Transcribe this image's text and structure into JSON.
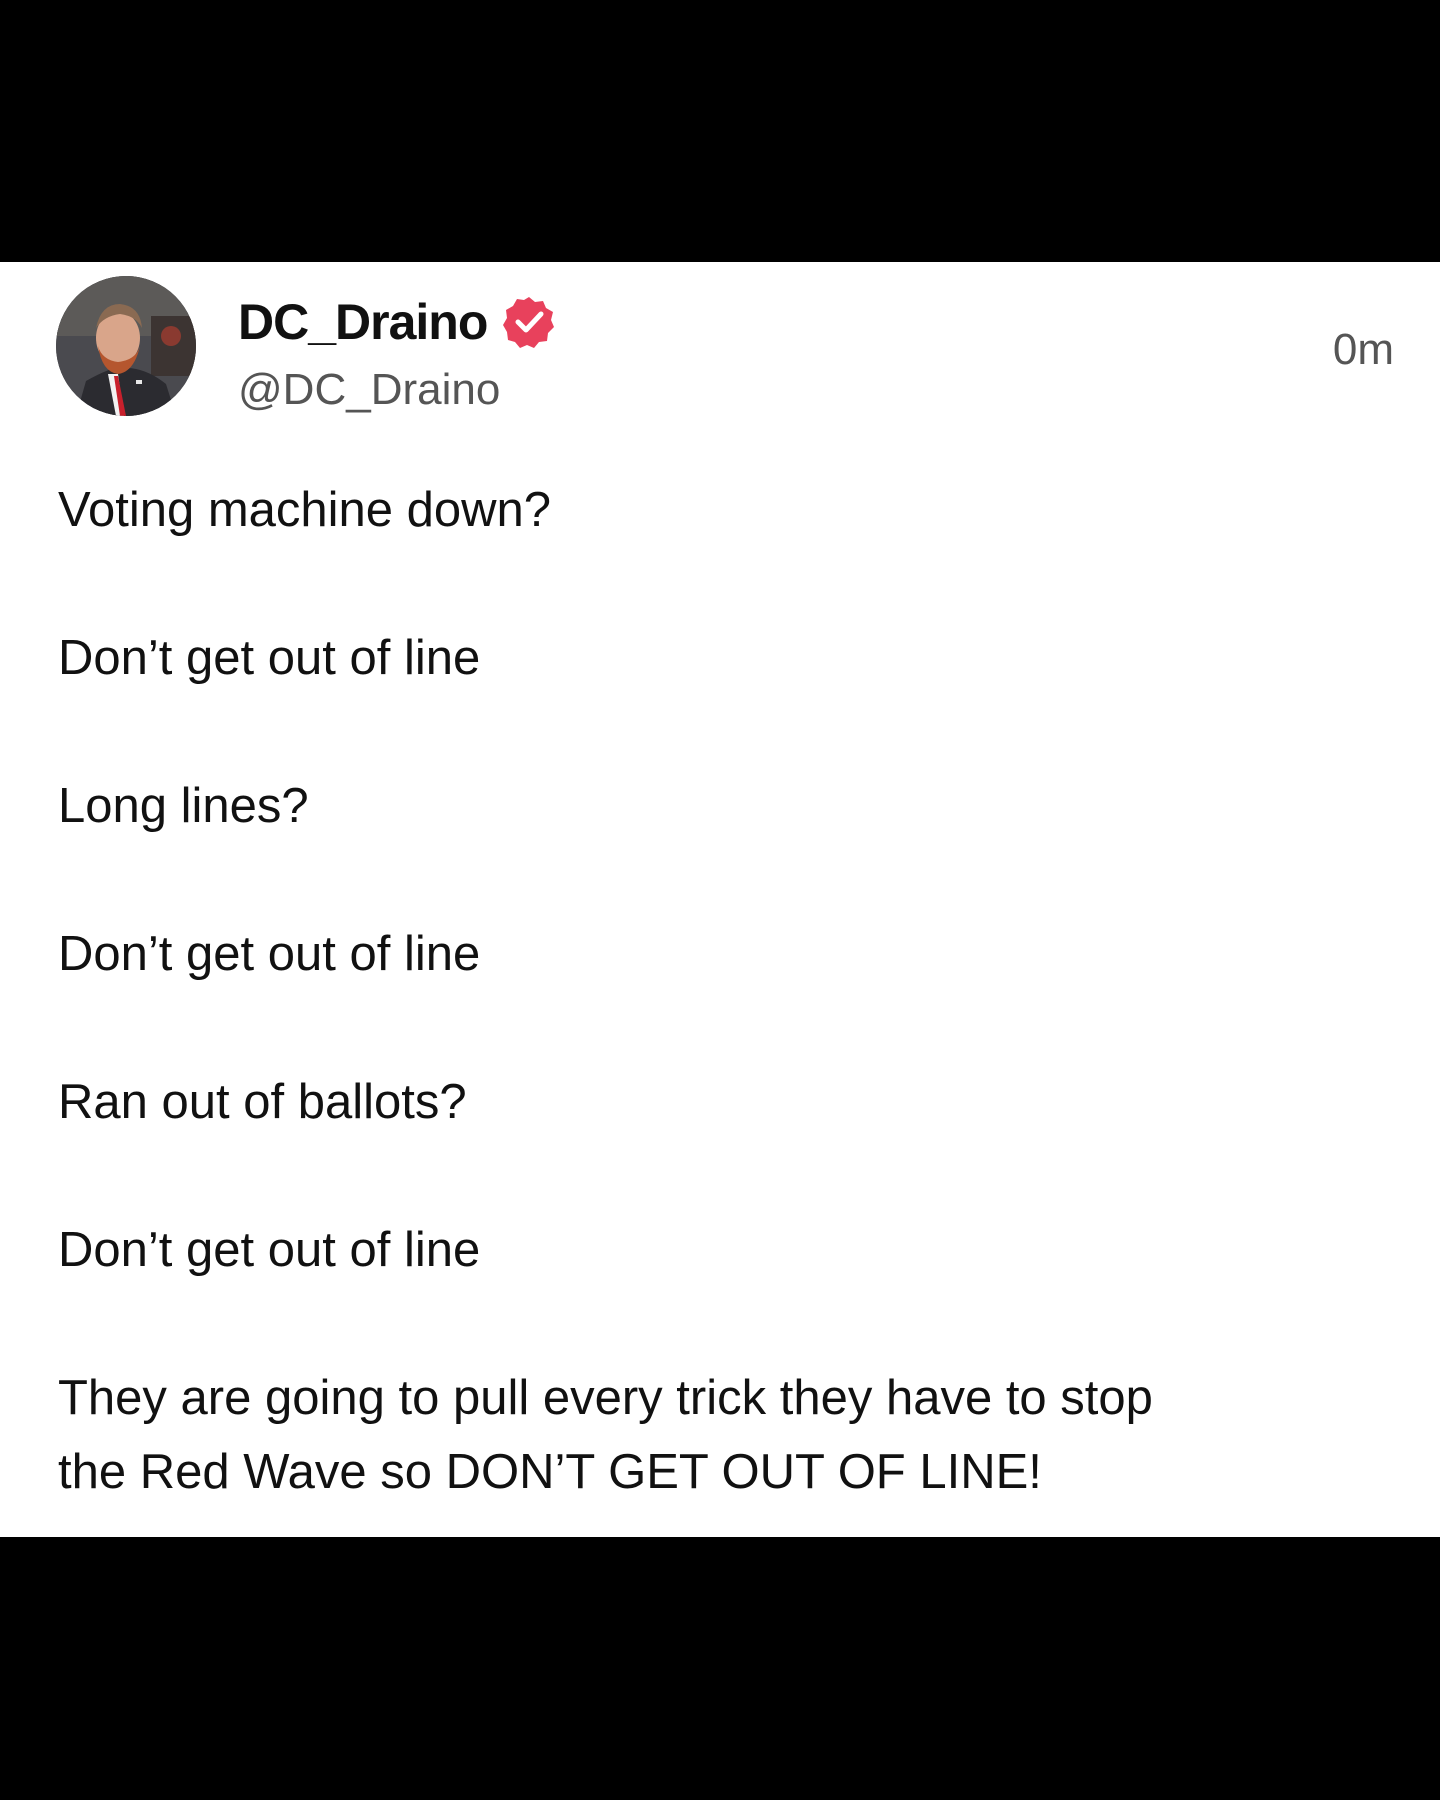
{
  "post": {
    "display_name": "DC_Draino",
    "handle": "@DC_Draino",
    "timestamp": "0m",
    "verified_color": "#e8415c",
    "lines": [
      "Voting machine down?",
      "Don’t get out of line",
      "Long lines?",
      "Don’t get out of line",
      "Ran out of ballots?",
      "Don’t get out of line",
      "They are going to pull every trick they have to stop",
      "the Red Wave so DON’T GET OUT OF LINE!"
    ]
  }
}
